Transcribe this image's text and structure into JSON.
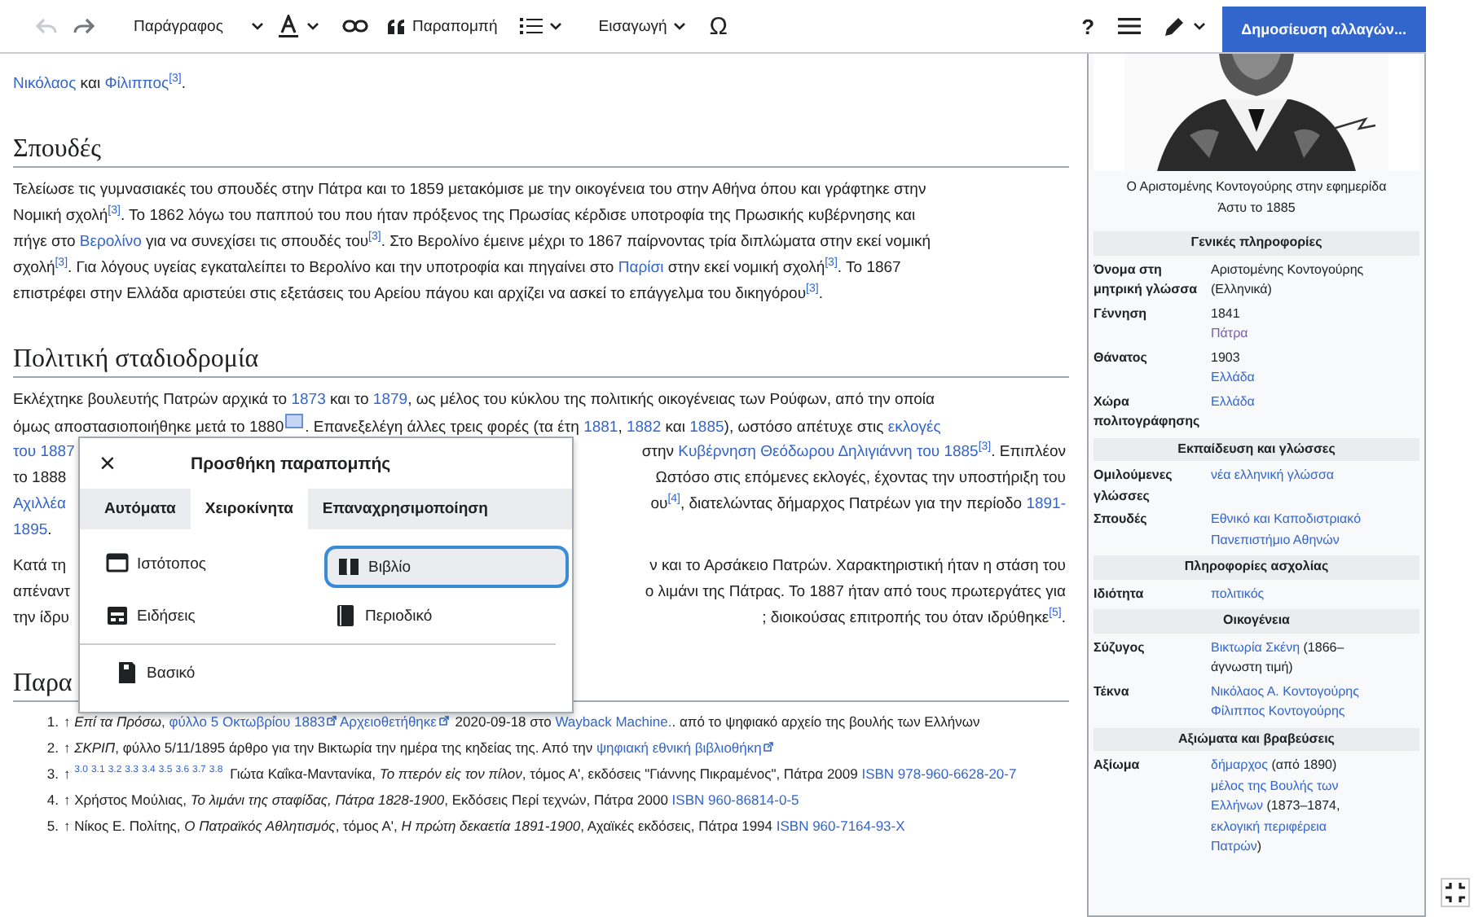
{
  "toolbar": {
    "undo": {
      "disabled": true
    },
    "redo": {
      "disabled": false
    },
    "format_menu": {
      "label": "Παράγραφος"
    },
    "cite_button": {
      "label": "Παραπομπή"
    },
    "insert_menu": {
      "label": "Εισαγωγή"
    },
    "special_character": "Ω",
    "help": "?",
    "publish_button": {
      "label": "Δημοσίευση αλλαγών..."
    }
  },
  "article": [
    {
      "kind": "paragraph",
      "lines": [
        {
          "segments": [
            {
              "kind": "link",
              "text": "Νικόλαος"
            },
            {
              "kind": "text",
              "text": " και "
            },
            {
              "kind": "link",
              "text": "Φίλιππος"
            },
            {
              "kind": "ref",
              "text": "[3]"
            },
            {
              "kind": "text",
              "text": "."
            }
          ]
        }
      ]
    },
    {
      "kind": "heading",
      "text": "Σπουδές"
    },
    {
      "kind": "paragraph",
      "lines": [
        {
          "segments": [
            {
              "kind": "text",
              "text": "Τελείωσε τις γυμνασιακές του σπουδές στην Πάτρα και το 1859 μετακόμισε με την οικογένεια του στην Αθήνα όπου και γράφτηκε στην"
            }
          ]
        },
        {
          "segments": [
            {
              "kind": "text",
              "text": "Νομική σχολή"
            },
            {
              "kind": "ref",
              "text": "[3]"
            },
            {
              "kind": "text",
              "text": ". Το 1862 λόγω του παππού του που ήταν πρόξενος της Πρωσίας κέρδισε υποτροφία της Πρωσικής κυβέρνησης και"
            }
          ]
        },
        {
          "segments": [
            {
              "kind": "text",
              "text": "πήγε στο "
            },
            {
              "kind": "link",
              "text": "Βερολίνο"
            },
            {
              "kind": "text",
              "text": " για να συνεχίσει τις σπουδές του"
            },
            {
              "kind": "ref",
              "text": "[3]"
            },
            {
              "kind": "text",
              "text": ". Στο Βερολίνο έμεινε μέχρι το 1867 παίρνοντας τρία διπλώματα στην εκεί νομική"
            }
          ]
        },
        {
          "segments": [
            {
              "kind": "text",
              "text": "σχολή"
            },
            {
              "kind": "ref",
              "text": "[3]"
            },
            {
              "kind": "text",
              "text": ". Για λόγους υγείας εγκαταλείπει το Βερολίνο και την υποτροφία και πηγαίνει στο "
            },
            {
              "kind": "link",
              "text": "Παρίσι"
            },
            {
              "kind": "text",
              "text": " στην εκεί νομική σχολή"
            },
            {
              "kind": "ref",
              "text": "[3]"
            },
            {
              "kind": "text",
              "text": ". Το 1867"
            }
          ]
        },
        {
          "segments": [
            {
              "kind": "text",
              "text": "επιστρέφει στην Ελλάδα αριστεύει στις εξετάσεις του Αρείου πάγου και αρχίζει να ασκεί το επάγγελμα του δικηγόρου"
            },
            {
              "kind": "ref",
              "text": "[3]"
            },
            {
              "kind": "text",
              "text": "."
            }
          ]
        }
      ]
    },
    {
      "kind": "heading",
      "text": "Πολιτική σταδιοδρομία"
    },
    {
      "kind": "paragraph",
      "lines": [
        {
          "segments": [
            {
              "kind": "text",
              "text": "Εκλέχτηκε βουλευτής Πατρών αρχικά το "
            },
            {
              "kind": "link",
              "text": "1873"
            },
            {
              "kind": "text",
              "text": " και το "
            },
            {
              "kind": "link",
              "text": "1879"
            },
            {
              "kind": "text",
              "text": ", ως μέλος του κύκλου της πολιτικής οικογένειας των Ρούφων, από την οποία"
            }
          ]
        },
        {
          "segments": [
            {
              "kind": "text",
              "text": "όμως αποστασιοποιήθηκε μετά το 1880"
            },
            {
              "kind": "marker"
            },
            {
              "kind": "text",
              "text": ". Επανεξελέγη άλλες τρεις φορές (τα έτη "
            },
            {
              "kind": "link",
              "text": "1881"
            },
            {
              "kind": "text",
              "text": ", "
            },
            {
              "kind": "link",
              "text": "1882"
            },
            {
              "kind": "text",
              "text": " και "
            },
            {
              "kind": "link",
              "text": "1885"
            },
            {
              "kind": "text",
              "text": "), ωστόσο απέτυχε στις "
            },
            {
              "kind": "link",
              "text": "εκλογές"
            }
          ]
        },
        {
          "segments": [
            {
              "kind": "link",
              "text": "του 1887"
            }
          ],
          "right": [
            {
              "kind": "text",
              "text": "στην "
            },
            {
              "kind": "link",
              "text": "Κυβέρνηση Θεόδωρου Δηλιγιάννη του 1885"
            },
            {
              "kind": "ref",
              "text": "[3]"
            },
            {
              "kind": "text",
              "text": ". Επιπλέον"
            }
          ]
        },
        {
          "segments": [
            {
              "kind": "text",
              "text": "το 1888"
            }
          ],
          "right": [
            {
              "kind": "text",
              "text": "Ωστόσο στις επόμενες εκλογές, έχοντας την υποστήριξη του"
            }
          ]
        },
        {
          "segments": [
            {
              "kind": "link",
              "text": "Αχιλλέα"
            }
          ],
          "right": [
            {
              "kind": "text",
              "text": "ου"
            },
            {
              "kind": "ref",
              "text": "[4]"
            },
            {
              "kind": "text",
              "text": ", διατελώντας δήμαρχος Πατρέων για την περίοδο "
            },
            {
              "kind": "link",
              "text": "1891-"
            }
          ]
        },
        {
          "segments": [
            {
              "kind": "link",
              "text": "1895"
            },
            {
              "kind": "text",
              "text": "."
            }
          ]
        }
      ]
    },
    {
      "kind": "paragraph",
      "lines": [
        {
          "segments": [
            {
              "kind": "text",
              "text": "Κατά τη"
            }
          ],
          "right": [
            {
              "kind": "text",
              "text": "ν και το Αρσάκειο Πατρών. Χαρακτηριστική ήταν η στάση του"
            }
          ]
        },
        {
          "segments": [
            {
              "kind": "text",
              "text": "απέναντ"
            }
          ],
          "right": [
            {
              "kind": "text",
              "text": "ο λιμάνι της Πάτρας. Το 1887 ήταν από τους πρωτεργάτες για"
            }
          ]
        },
        {
          "segments": [
            {
              "kind": "text",
              "text": "την ίδρυ"
            }
          ],
          "right": [
            {
              "kind": "text",
              "text": "; διοικούσας επιτροπής του όταν ιδρύθηκε"
            },
            {
              "kind": "ref",
              "text": "[5]"
            },
            {
              "kind": "text",
              "text": "."
            }
          ]
        }
      ]
    },
    {
      "kind": "heading",
      "text": "Παρα"
    }
  ],
  "references": [
    {
      "number": "1.",
      "segments": [
        {
          "kind": "text",
          "text": "↑ "
        },
        {
          "kind": "italic",
          "text": "Επί τα Πρόσω"
        },
        {
          "kind": "text",
          "text": ", "
        },
        {
          "kind": "ext",
          "text": "φύλλο 5 Οκτωβρίου 1883"
        },
        {
          "kind": "ext",
          "text": "Αρχειοθετήθηκε"
        },
        {
          "kind": "text",
          "text": " 2020-09-18 στο "
        },
        {
          "kind": "link",
          "text": "Wayback Machine."
        },
        {
          "kind": "text",
          "text": ". από το ψηφιακό αρχείο της βουλής των Ελλήνων"
        }
      ]
    },
    {
      "number": "2.",
      "segments": [
        {
          "kind": "text",
          "text": "↑ "
        },
        {
          "kind": "italic",
          "text": "ΣΚΡΙΠ"
        },
        {
          "kind": "text",
          "text": ", φύλλο 5/11/1895 άρθρο για την Βικτωρία την ημέρα της κηδείας της. Από την "
        },
        {
          "kind": "ext",
          "text": "ψηφιακή εθνική βιβλιοθήκη"
        }
      ]
    },
    {
      "number": "3.",
      "segments": [
        {
          "kind": "text",
          "text": "↑ "
        },
        {
          "kind": "backref",
          "text": "3.0"
        },
        {
          "kind": "backref",
          "text": "3.1"
        },
        {
          "kind": "backref",
          "text": "3.2"
        },
        {
          "kind": "backref",
          "text": "3.3"
        },
        {
          "kind": "backref",
          "text": "3.4"
        },
        {
          "kind": "backref",
          "text": "3.5"
        },
        {
          "kind": "backref",
          "text": "3.6"
        },
        {
          "kind": "backref",
          "text": "3.7"
        },
        {
          "kind": "backref",
          "text": "3.8"
        },
        {
          "kind": "text",
          "text": " Γιώτα Καΐκα-Μαντανίκα, "
        },
        {
          "kind": "italic",
          "text": "Το πτερόν εἰς τον πίλον"
        },
        {
          "kind": "text",
          "text": ", τόμος Α', εκδόσεις \"Γιάννης Πικραμένος\", Πάτρα 2009 "
        },
        {
          "kind": "link",
          "text": "ISBN 978-960-6628-20-7"
        }
      ]
    },
    {
      "number": "4.",
      "segments": [
        {
          "kind": "text",
          "text": "↑ Χρήστος Μούλιας, "
        },
        {
          "kind": "italic",
          "text": "Το λιμάνι της σταφίδας, Πάτρα 1828-1900"
        },
        {
          "kind": "text",
          "text": ", Εκδόσεις Περί τεχνών, Πάτρα 2000 "
        },
        {
          "kind": "link",
          "text": "ISBN 960-86814-0-5"
        }
      ]
    },
    {
      "number": "5.",
      "segments": [
        {
          "kind": "text",
          "text": "↑ Νίκος Ε. Πολίτης, "
        },
        {
          "kind": "italic",
          "text": "Ο Πατραϊκός Αθλητισμός"
        },
        {
          "kind": "text",
          "text": ", τόμος Α', "
        },
        {
          "kind": "italic",
          "text": "Η πρώτη δεκαετία 1891-1900"
        },
        {
          "kind": "text",
          "text": ", Αχαϊκές εκδόσεις, Πάτρα 1994 "
        },
        {
          "kind": "link",
          "text": "ISBN 960-7164-93-X"
        }
      ]
    }
  ],
  "dialog": {
    "title": "Προσθήκη παραπομπής",
    "close": "×",
    "tabs": [
      {
        "label": "Αυτόματα",
        "selected": false
      },
      {
        "label": "Χειροκίνητα",
        "selected": true
      },
      {
        "label": "Επαναχρησιμοποίηση",
        "selected": false
      }
    ],
    "templates": [
      {
        "label": "Ιστότοπος",
        "kind": "website",
        "selected": false
      },
      {
        "label": "Βιβλίο",
        "kind": "book",
        "selected": true
      },
      {
        "label": "Ειδήσεις",
        "kind": "news",
        "selected": false
      },
      {
        "label": "Περιοδικό",
        "kind": "journal",
        "selected": false
      }
    ],
    "basic": {
      "label": "Βασικό"
    }
  },
  "infobox": {
    "caption": "Ο Αριστομένης Κοντογούρης στην εφημερίδα Άστυ το 1885",
    "entries": [
      {
        "kind": "header",
        "text": "Γενικές πληροφορίες"
      },
      {
        "kind": "row",
        "label": "Όνομα στη μητρική γλώσσα",
        "value": [
          [
            {
              "kind": "text",
              "text": "Αριστομένης Κοντογούρης"
            }
          ],
          [
            {
              "kind": "text",
              "text": "(Ελληνικά)"
            }
          ]
        ]
      },
      {
        "kind": "row",
        "label": "Γέννηση",
        "value": [
          [
            {
              "kind": "text",
              "text": "1841"
            }
          ],
          [
            {
              "kind": "visited",
              "text": "Πάτρα"
            }
          ]
        ]
      },
      {
        "kind": "row",
        "label": "Θάνατος",
        "value": [
          [
            {
              "kind": "text",
              "text": "1903"
            }
          ],
          [
            {
              "kind": "link",
              "text": "Ελλάδα"
            }
          ]
        ]
      },
      {
        "kind": "row",
        "label": "Χώρα πολιτογράφησης",
        "value": [
          [
            {
              "kind": "link",
              "text": "Ελλάδα"
            }
          ]
        ]
      },
      {
        "kind": "header",
        "text": "Εκπαίδευση και γλώσσες"
      },
      {
        "kind": "row",
        "label": "Ομιλούμενες γλώσσες",
        "value": [
          [
            {
              "kind": "link",
              "text": "νέα ελληνική γλώσσα"
            }
          ]
        ]
      },
      {
        "kind": "row",
        "label": "Σπουδές",
        "value": [
          [
            {
              "kind": "link",
              "text": "Εθνικό και Καποδιστριακό"
            }
          ],
          [
            {
              "kind": "link",
              "text": "Πανεπιστήμιο Αθηνών"
            }
          ]
        ]
      },
      {
        "kind": "header",
        "text": "Πληροφορίες ασχολίας"
      },
      {
        "kind": "row",
        "label": "Ιδιότητα",
        "value": [
          [
            {
              "kind": "link",
              "text": "πολιτικός"
            }
          ]
        ]
      },
      {
        "kind": "header",
        "text": "Οικογένεια"
      },
      {
        "kind": "row",
        "label": "Σύζυγος",
        "value": [
          [
            {
              "kind": "link",
              "text": "Βικτωρία Σκένη"
            },
            {
              "kind": "text",
              "text": " (1866–"
            }
          ],
          [
            {
              "kind": "text",
              "text": "άγνωστη τιμή)"
            }
          ]
        ]
      },
      {
        "kind": "row",
        "label": "Τέκνα",
        "value": [
          [
            {
              "kind": "link",
              "text": "Νικόλαος Α. Κοντογούρης"
            }
          ],
          [
            {
              "kind": "link",
              "text": "Φίλιππος Κοντογούρης"
            }
          ]
        ]
      },
      {
        "kind": "header",
        "text": "Αξιώματα και βραβεύσεις"
      },
      {
        "kind": "row",
        "label": "Αξίωμα",
        "value": [
          [
            {
              "kind": "link",
              "text": "δήμαρχος"
            },
            {
              "kind": "text",
              "text": " (από 1890)"
            }
          ],
          [
            {
              "kind": "link",
              "text": "μέλος της Βουλής των"
            }
          ],
          [
            {
              "kind": "link",
              "text": "Ελλήνων"
            },
            {
              "kind": "text",
              "text": " (1873–1874,"
            }
          ],
          [
            {
              "kind": "link",
              "text": "εκλογική περιφέρεια"
            }
          ],
          [
            {
              "kind": "link",
              "text": "Πατρών"
            },
            {
              "kind": "text",
              "text": ")"
            }
          ]
        ]
      }
    ]
  }
}
